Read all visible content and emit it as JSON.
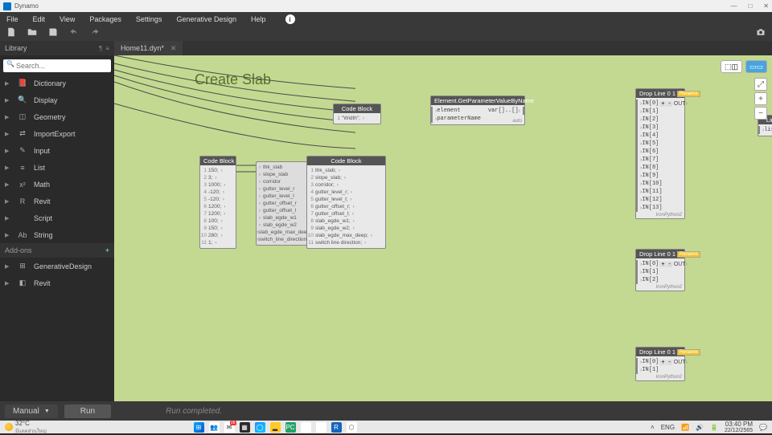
{
  "app": {
    "title": "Dynamo"
  },
  "menus": [
    "File",
    "Edit",
    "View",
    "Packages",
    "Settings",
    "Generative Design",
    "Help"
  ],
  "library": {
    "title": "Library",
    "search_placeholder": "Search...",
    "items": [
      {
        "icon": "📕",
        "label": "Dictionary"
      },
      {
        "icon": "🔍",
        "label": "Display"
      },
      {
        "icon": "◫",
        "label": "Geometry"
      },
      {
        "icon": "⇄",
        "label": "ImportExport"
      },
      {
        "icon": "✎",
        "label": "Input"
      },
      {
        "icon": "≡",
        "label": "List"
      },
      {
        "icon": "x²",
        "label": "Math"
      },
      {
        "icon": "R",
        "label": "Revit"
      },
      {
        "icon": "</>",
        "label": "Script"
      },
      {
        "icon": "Ab",
        "label": "String"
      }
    ],
    "addons_title": "Add-ons",
    "addons": [
      {
        "icon": "⊞",
        "label": "GenerativeDesign"
      },
      {
        "icon": "◧",
        "label": "Revit"
      }
    ]
  },
  "tab": {
    "title": "Home11.dyn*"
  },
  "canvas": {
    "title": "Create Slab",
    "code_block_small": {
      "header": "Code Block",
      "text": "\"Width\";"
    },
    "getparam": {
      "header": "Element.GetParameterValueByName",
      "in": [
        "element",
        "parameterName"
      ],
      "out": "var[]..[]",
      "lacing": "auto"
    },
    "code_block_nums": {
      "header": "Code Block",
      "lines": [
        "150;",
        "3;",
        "1000;",
        "-120;",
        "-120;",
        "1200;",
        "1200;",
        "100;",
        "150;",
        "280;",
        "1;"
      ]
    },
    "code_block_vars": {
      "header": "",
      "in": [
        "thk_slab",
        "slope_slab",
        "corridor",
        "gutter_level_r",
        "gutter_level_l",
        "gutter_offset_r",
        "gutter_offset_l",
        "slab_egde_w1",
        "slab_egde_w2",
        "slab_egde_max_deep",
        "switch_line_direction"
      ]
    },
    "code_block_out": {
      "header": "Code Block",
      "lines": [
        "thk_slab;",
        "slope_slab;",
        "corridor;",
        "gutter_level_r;",
        "gutter_level_l;",
        "gutter_offset_r;",
        "gutter_offset_l;",
        "slab_egde_w1;",
        "slab_egde_w2;",
        "slab_egde_max_deep;",
        "switch line direction;"
      ]
    },
    "drop_line_a": {
      "header": "Drop Line 0 1",
      "badge": "Rename",
      "ports": [
        "IN[0]",
        "IN[1]",
        "IN[2]",
        "IN[3]",
        "IN[4]",
        "IN[5]",
        "IN[6]",
        "IN[7]",
        "IN[8]",
        "IN[9]",
        "IN[10]",
        "IN[11]",
        "IN[12]",
        "IN[13]"
      ],
      "out": "OUT",
      "lacing": "IronPython2"
    },
    "drop_line_b": {
      "header": "Drop Line 0 1",
      "badge": "Rename",
      "ports": [
        "IN[0]",
        "IN[1]",
        "IN[2]"
      ],
      "out": "OUT",
      "lacing": "IronPython2"
    },
    "drop_line_c": {
      "header": "Drop Line 0 1",
      "badge": "Rename",
      "ports": [
        "IN[0]",
        "IN[1]"
      ],
      "out": "OUT",
      "lacing": "IronPython2"
    },
    "lines_node": {
      "header": "Line",
      "row": "lists"
    }
  },
  "run": {
    "mode": "Manual",
    "button": "Run",
    "status": "Run completed."
  },
  "taskbar": {
    "temp": "32°C",
    "desc": "มีแดดส่วนใหญ่",
    "lang_short": "ENG",
    "time": "03:40 PM",
    "date": "22/12/2565"
  }
}
